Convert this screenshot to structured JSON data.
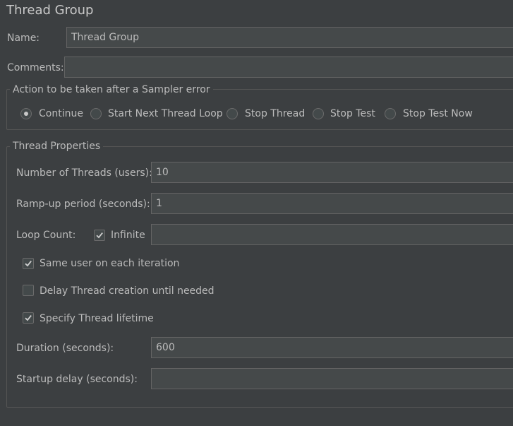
{
  "title": "Thread Group",
  "name": {
    "label": "Name:",
    "value": "Thread Group"
  },
  "comments": {
    "label": "Comments:",
    "value": ""
  },
  "sampler_error": {
    "title": "Action to be taken after a Sampler error",
    "options": [
      "Continue",
      "Start Next Thread Loop",
      "Stop Thread",
      "Stop Test",
      "Stop Test Now"
    ],
    "selected": "Continue"
  },
  "thread_props": {
    "title": "Thread Properties",
    "num_threads": {
      "label": "Number of Threads (users):",
      "value": "10"
    },
    "ramp_up": {
      "label": "Ramp-up period (seconds):",
      "value": "1"
    },
    "loop_count": {
      "label": "Loop Count:",
      "infinite_label": "Infinite",
      "infinite_checked": true,
      "value": ""
    },
    "same_user": {
      "label": "Same user on each iteration",
      "checked": true
    },
    "delay_creation": {
      "label": "Delay Thread creation until needed",
      "checked": false
    },
    "specify_lifetime": {
      "label": "Specify Thread lifetime",
      "checked": true
    },
    "duration": {
      "label": "Duration (seconds):",
      "value": "600"
    },
    "startup_delay": {
      "label": "Startup delay (seconds):",
      "value": ""
    }
  }
}
